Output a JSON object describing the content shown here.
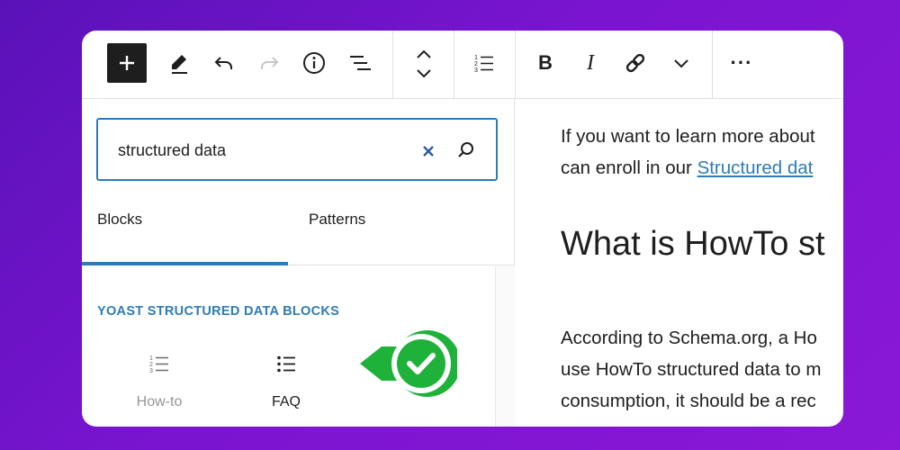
{
  "toolbar": {
    "buttons": [
      {
        "name": "add-block",
        "icon": "plus-icon"
      },
      {
        "name": "tools",
        "icon": "pencil-icon"
      },
      {
        "name": "undo",
        "icon": "undo-icon"
      },
      {
        "name": "redo",
        "icon": "redo-icon"
      },
      {
        "name": "details",
        "icon": "info-icon"
      },
      {
        "name": "list-view",
        "icon": "list-view-icon"
      },
      {
        "name": "move",
        "icon": "chevron-up-down-icon"
      },
      {
        "name": "ordered-list",
        "icon": "ordered-list-icon"
      },
      {
        "name": "link",
        "icon": "link-icon"
      },
      {
        "name": "more-formatting",
        "icon": "chevron-down-icon"
      },
      {
        "name": "options",
        "icon": "ellipsis-icon"
      }
    ],
    "bold_label": "B",
    "italic_label": "I",
    "options_label": "···"
  },
  "search": {
    "value": "structured data",
    "placeholder": "Search"
  },
  "tabs": [
    {
      "label": "Blocks",
      "active": true
    },
    {
      "label": "Patterns",
      "active": false
    }
  ],
  "category": {
    "title": "YOAST STRUCTURED DATA BLOCKS"
  },
  "blocks": [
    {
      "label": "How-to",
      "icon": "ordered-list-icon"
    },
    {
      "label": "FAQ",
      "icon": "list-icon"
    }
  ],
  "badge": {
    "icon": "checkmark-icon",
    "color": "#1fb23a"
  },
  "content": {
    "para1_line1": "If you want to learn more about",
    "para1_line2_prefix": "can enroll in our ",
    "para1_link": "Structured dat",
    "heading": "What is HowTo st",
    "para2_line1": "According to Schema.org, a Ho",
    "para2_line2": "use HowTo structured data to m",
    "para2_line3": "consumption, it should be a rec"
  },
  "colors": {
    "accent": "#2c7bb6",
    "background_start": "#5a12b8",
    "background_end": "#8a18d6",
    "check_green": "#1fb23a"
  }
}
